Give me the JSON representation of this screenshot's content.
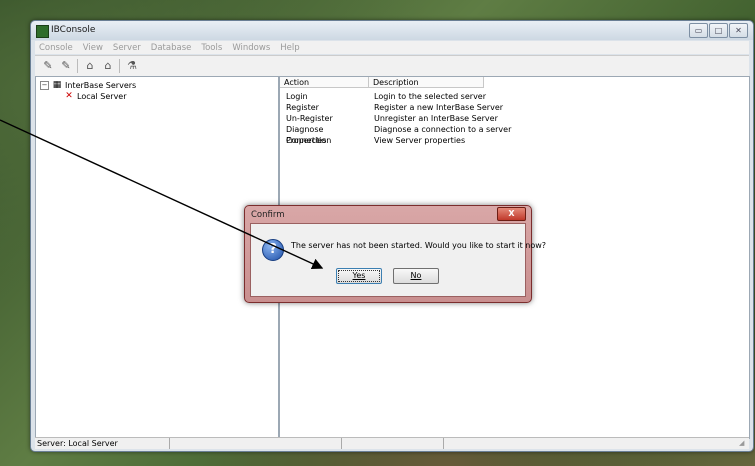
{
  "window": {
    "title": "IBConsole",
    "icon": "ibconsole-icon",
    "buttons": [
      "minimize",
      "maximize",
      "close"
    ]
  },
  "menubar": {
    "items": [
      "Console",
      "View",
      "Server",
      "Database",
      "Tools",
      "Windows",
      "Help"
    ]
  },
  "toolbar": {
    "icons": [
      "register-server-icon",
      "unregister-server-icon",
      "database-connect-icon",
      "database-disconnect-icon",
      "sql-icon"
    ]
  },
  "tree": {
    "root": {
      "label": "InterBase Servers",
      "expander": "−",
      "icon": "servers-icon"
    },
    "child": {
      "label": "Local Server",
      "icon": "server-disconnected-icon"
    }
  },
  "grid": {
    "headers": [
      "Action",
      "Description"
    ],
    "rows": [
      {
        "action": "Login",
        "description": "Login to the selected server"
      },
      {
        "action": "Register",
        "description": "Register a new InterBase Server"
      },
      {
        "action": "Un-Register",
        "description": "Unregister an InterBase Server"
      },
      {
        "action": "Diagnose Connection",
        "description": "Diagnose a connection to a server"
      },
      {
        "action": "Properties",
        "description": "View Server properties"
      }
    ]
  },
  "statusbar": {
    "text": "Server: Local Server"
  },
  "dialog": {
    "title": "Confirm",
    "close_glyph": "X",
    "message": "The server has not been started. Would you like to start it now?",
    "yes_label": "Yes",
    "no_label": "No",
    "icon": "question-icon"
  },
  "colors": {
    "dialog_frame": "#c98f8f",
    "close_button": "#c0392b",
    "question_icon": "#1d4fa8"
  }
}
